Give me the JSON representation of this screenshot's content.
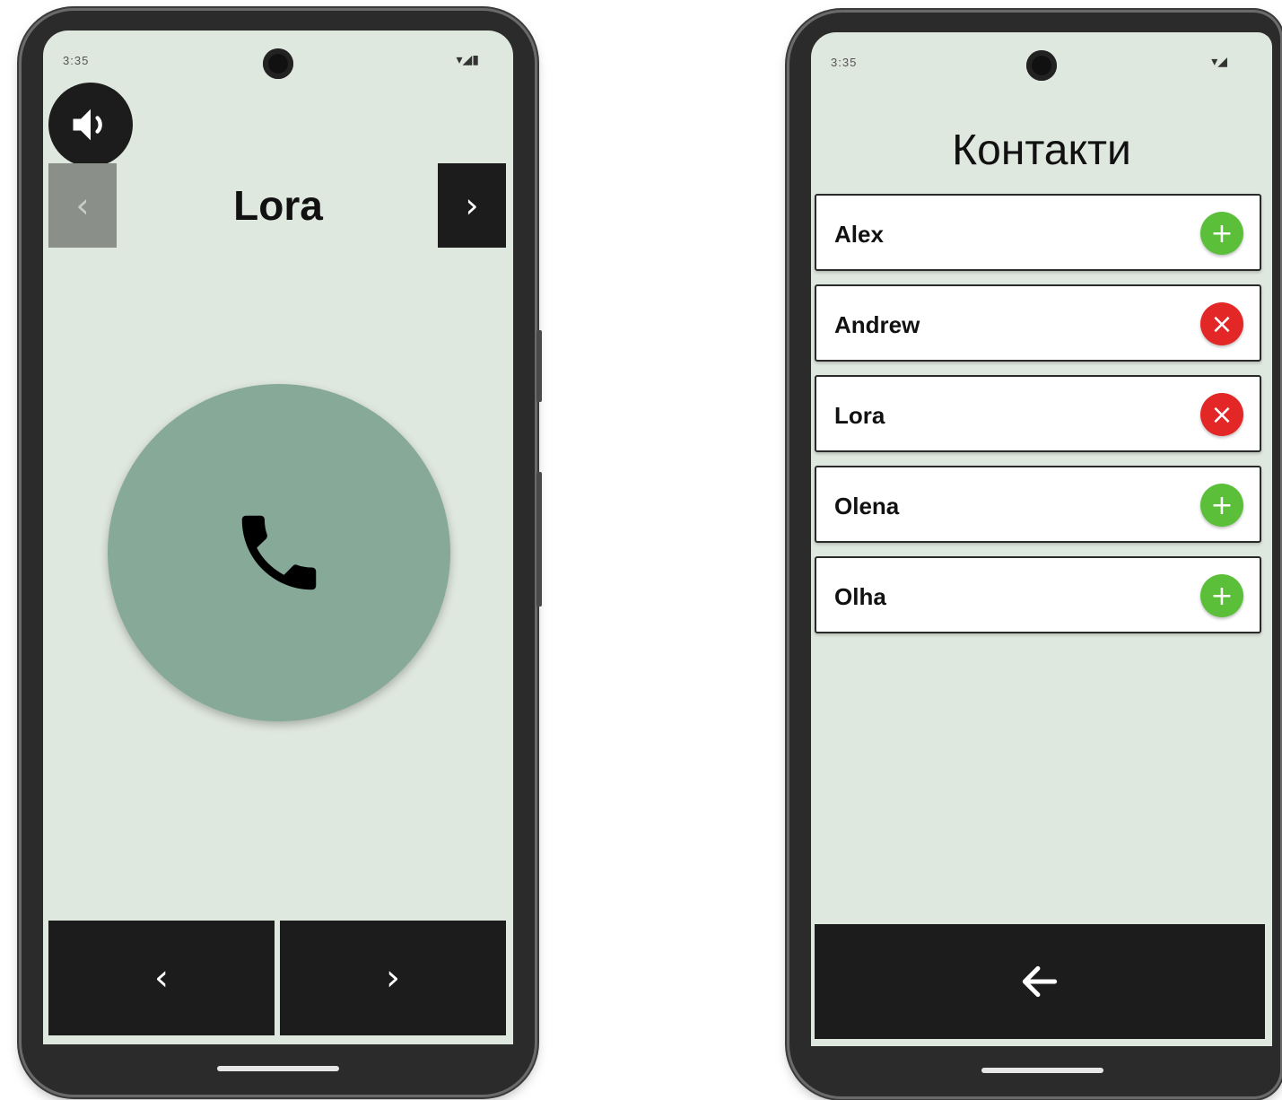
{
  "colors": {
    "screen_bg": "#dfe8df",
    "dark": "#1c1c1c",
    "call_green": "#86a998",
    "add_green": "#5cbf3a",
    "remove_red": "#e32626"
  },
  "left_screen": {
    "status": {
      "time": "3:35",
      "icons": "▾◢▮"
    },
    "speaker_icon": "speaker-icon",
    "prev_small": "‹",
    "next_small": "›",
    "contact_name": "Lora",
    "call_icon": "phone-icon",
    "bottom_nav": {
      "prev": "‹",
      "next": "›"
    }
  },
  "right_screen": {
    "status": {
      "time": "3:35",
      "icons": "▾◢"
    },
    "title": "Контакти",
    "contacts": [
      {
        "name": "Alex",
        "action": "add",
        "symbol": "+"
      },
      {
        "name": "Andrew",
        "action": "remove",
        "symbol": "×"
      },
      {
        "name": "Lora",
        "action": "remove",
        "symbol": "×"
      },
      {
        "name": "Olena",
        "action": "add",
        "symbol": "+"
      },
      {
        "name": "Olha",
        "action": "add",
        "symbol": "+"
      }
    ],
    "back_icon": "arrow-left-icon"
  }
}
